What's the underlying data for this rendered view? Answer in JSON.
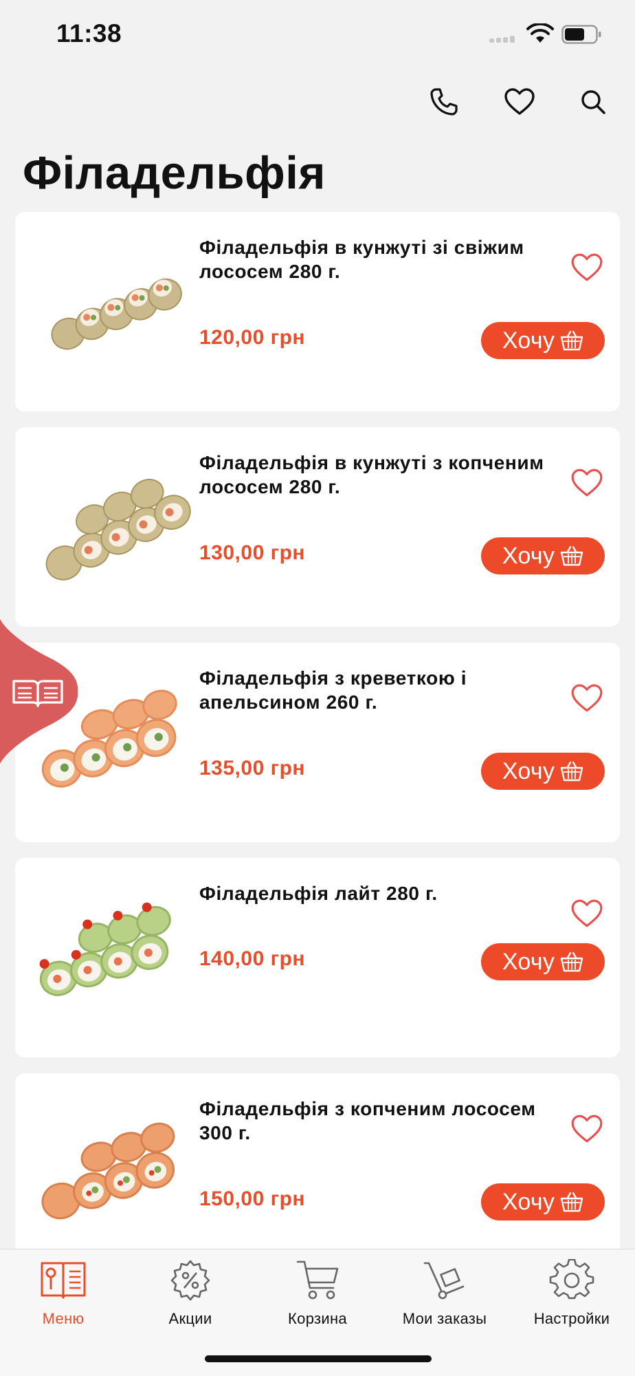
{
  "status_bar": {
    "time": "11:38"
  },
  "header": {
    "title": "Філадельфія",
    "icons": [
      "phone-icon",
      "heart-icon",
      "search-icon"
    ]
  },
  "colors": {
    "accent": "#ec4a28",
    "price": "#e84e2a",
    "side_tab": "#d95c5c",
    "background": "#f2f2f2"
  },
  "products": [
    {
      "title": "Філадельфія в кунжуті зі свіжим лососем 280 г.",
      "price": "120,00 грн",
      "button": "Хочу"
    },
    {
      "title": "Філадельфія в кунжуті з копченим лососем 280 г.",
      "price": "130,00 грн",
      "button": "Хочу"
    },
    {
      "title": "Філадельфія з креветкою і апельсином 260 г.",
      "price": "135,00 грн",
      "button": "Хочу"
    },
    {
      "title": "Філадельфія лайт 280 г.",
      "price": "140,00 грн",
      "button": "Хочу"
    },
    {
      "title": "Філадельфія з копченим лососем 300 г.",
      "price": "150,00 грн",
      "button": "Хочу"
    }
  ],
  "tabbar": {
    "active": "Меню",
    "items": [
      {
        "label": "Меню",
        "icon": "menu-book-icon"
      },
      {
        "label": "Акции",
        "icon": "discount-gear-icon"
      },
      {
        "label": "Корзина",
        "icon": "cart-icon"
      },
      {
        "label": "Мои заказы",
        "icon": "hand-truck-icon"
      },
      {
        "label": "Настройки",
        "icon": "gear-icon"
      }
    ]
  }
}
